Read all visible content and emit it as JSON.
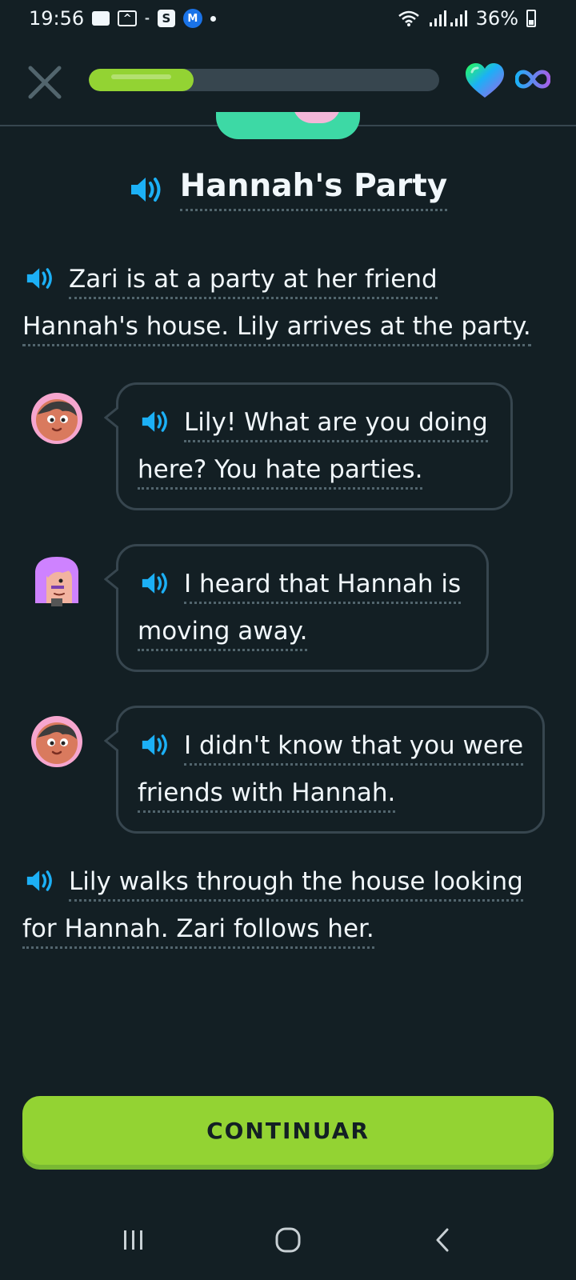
{
  "status_bar": {
    "time": "19:56",
    "battery": "36%",
    "icons": [
      "chat-icon",
      "triangle-app-icon",
      "s-app-icon",
      "m-app-icon",
      "notification-dot-icon",
      "wifi-icon",
      "signal-icon",
      "battery-icon"
    ]
  },
  "lesson": {
    "progress_fraction": 0.3,
    "hearts": "infinite"
  },
  "story": {
    "title": "Hannah's Party",
    "intro": "Zari is at a party at her friend Hannah's house. Lily arrives at the party.",
    "lines": [
      {
        "speaker": "Zari",
        "text": "Lily! What are you doing here? You hate parties."
      },
      {
        "speaker": "Lily",
        "text": "I heard that Hannah is moving away."
      },
      {
        "speaker": "Zari",
        "text": "I didn't know that you were friends with Hannah."
      }
    ],
    "outro": "Lily walks through the house looking for Hannah. Zari follows her."
  },
  "continue_label": "CONTINUAR",
  "colors": {
    "background": "#131f24",
    "accent_green": "#93d333",
    "speaker_blue": "#1cb0f6",
    "border": "#37464f"
  }
}
